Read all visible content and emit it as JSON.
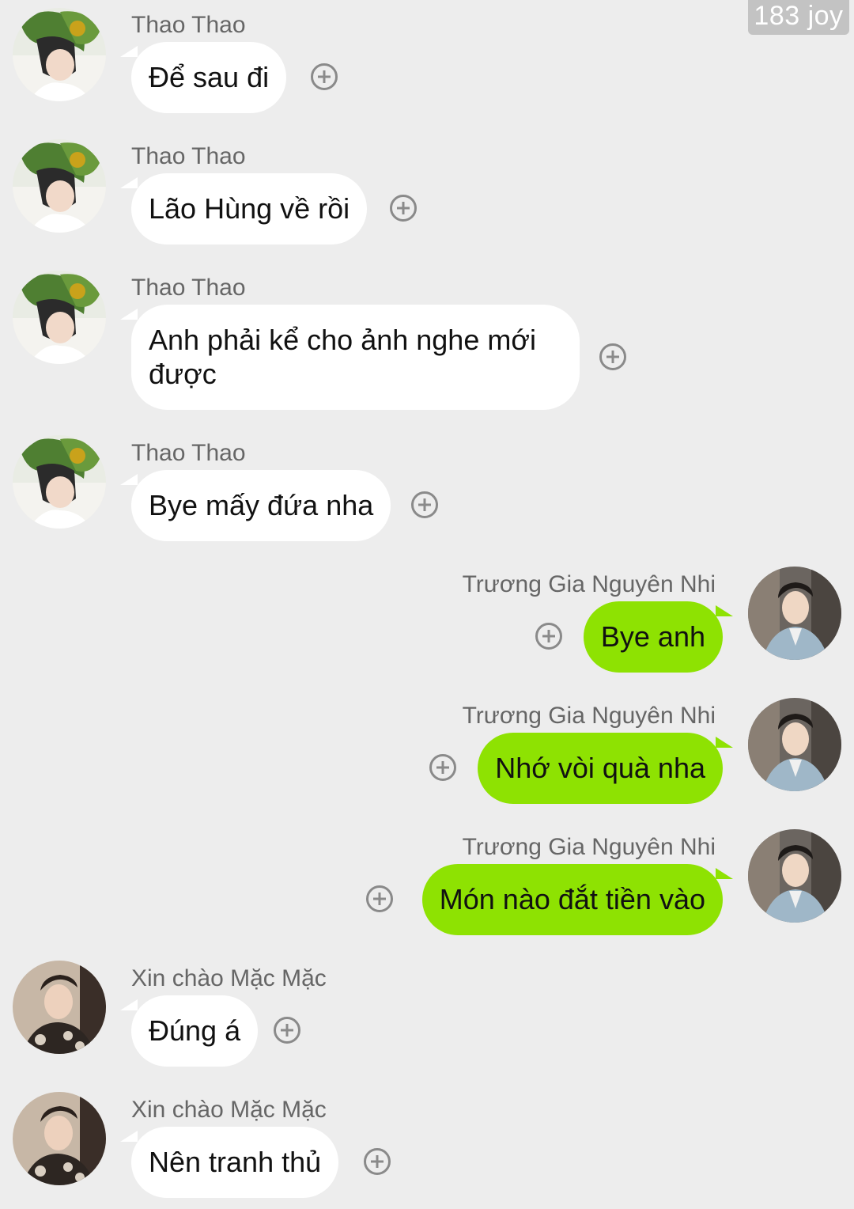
{
  "watermark": "183 joy",
  "messages": [
    {
      "sender": "Thao Thao",
      "text": "Để sau đi"
    },
    {
      "sender": "Thao Thao",
      "text": "Lão Hùng về rồi"
    },
    {
      "sender": "Thao Thao",
      "text": "Anh phải kể cho ảnh nghe mới được"
    },
    {
      "sender": "Thao Thao",
      "text": "Bye mấy đứa nha"
    },
    {
      "sender": "Trương Gia Nguyên Nhi",
      "text": "Bye anh"
    },
    {
      "sender": "Trương Gia Nguyên Nhi",
      "text": "Nhớ vòi quà nha"
    },
    {
      "sender": "Trương Gia Nguyên Nhi",
      "text": "Món nào đắt tiền vào"
    },
    {
      "sender": "Xin chào Mặc Mặc",
      "text": "Đúng á"
    },
    {
      "sender": "Xin chào Mặc Mặc",
      "text": "Nên tranh thủ"
    }
  ],
  "colors": {
    "background": "#ededed",
    "incoming_bubble": "#ffffff",
    "outgoing_bubble": "#8ee202"
  },
  "icons": {
    "reaction": "plus-circle-icon",
    "avatar": "user-avatar"
  }
}
